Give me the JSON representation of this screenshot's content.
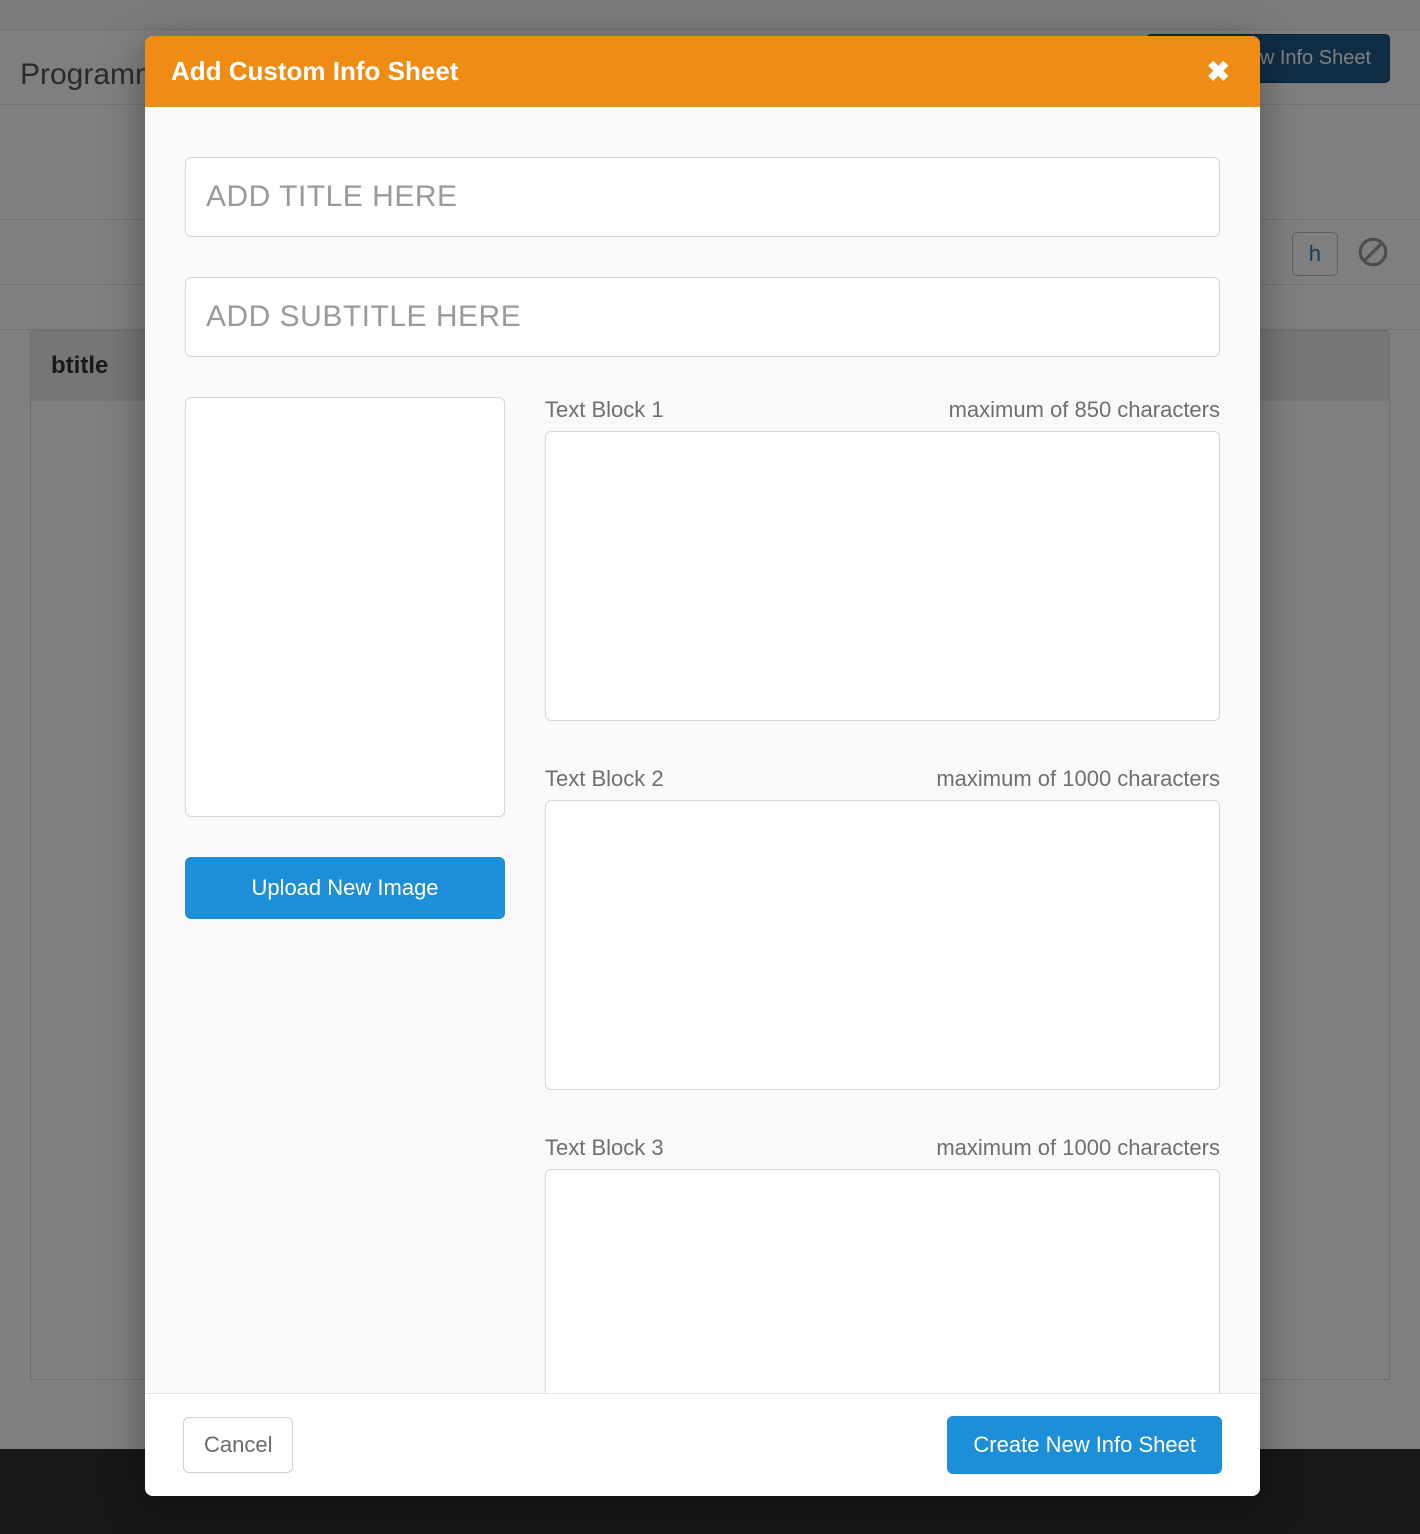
{
  "background": {
    "page_title_fragment": "Programm",
    "upload_button": "Upload New Info Sheet",
    "search_button_fragment": "h",
    "table_head_fragment": "btitle"
  },
  "modal": {
    "title": "Add Custom Info Sheet",
    "close_symbol": "✖",
    "title_input": {
      "placeholder": "ADD TITLE HERE",
      "value": ""
    },
    "subtitle_input": {
      "placeholder": "ADD SUBTITLE HERE",
      "value": ""
    },
    "upload_image_button": "Upload New Image",
    "text_blocks": [
      {
        "label": "Text Block 1",
        "max_note": "maximum of 850 characters",
        "value": ""
      },
      {
        "label": "Text Block 2",
        "max_note": "maximum of 1000 characters",
        "value": ""
      },
      {
        "label": "Text Block 3",
        "max_note": "maximum of 1000 characters",
        "value": ""
      }
    ],
    "footer": {
      "cancel": "Cancel",
      "create": "Create New Info Sheet"
    }
  }
}
